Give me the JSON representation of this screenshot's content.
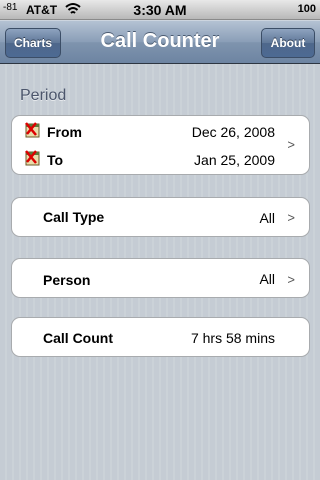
{
  "status_bar": {
    "signal": "-81",
    "carrier": "AT&T",
    "time": "3:30 AM",
    "battery": "100"
  },
  "nav": {
    "title": "Call Counter",
    "left_button": "Charts",
    "right_button": "About"
  },
  "period": {
    "header": "Period",
    "from_label": "From",
    "from_value": "Dec 26, 2008",
    "to_label": "To",
    "to_value": "Jan 25, 2009",
    "chevron": ">"
  },
  "call_type": {
    "label": "Call Type",
    "value": "All",
    "chevron": ">"
  },
  "person": {
    "label": "Person",
    "value": "All",
    "chevron": ">"
  },
  "call_count": {
    "label": "Call Count",
    "value": "7 hrs 58 mins"
  },
  "colors": {
    "background": "#c5ccd4",
    "navbar": "#6d84a2",
    "section_header": "#4c566c"
  }
}
